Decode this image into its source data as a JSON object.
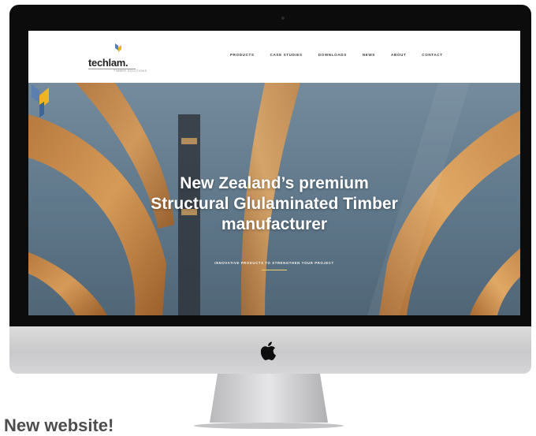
{
  "site": {
    "brand_name": "techlam.",
    "brand_tagline": "timber solutions"
  },
  "nav": {
    "items": [
      "PRODUCTS",
      "CASE STUDIES",
      "DOWNLOADS",
      "NEWS",
      "ABOUT",
      "CONTACT"
    ]
  },
  "hero": {
    "title_lines": [
      "New Zealand’s premium",
      "Structural Glulaminated Timber",
      "manufacturer"
    ],
    "subtitle": "INNOVATIVE PRODUCTS TO STRENGTHEN YOUR PROJECT"
  },
  "caption": "New website!",
  "colors": {
    "accent": "#f0b323",
    "logo_blue": "#5b7fae",
    "bezel": "#0c0c0d"
  }
}
